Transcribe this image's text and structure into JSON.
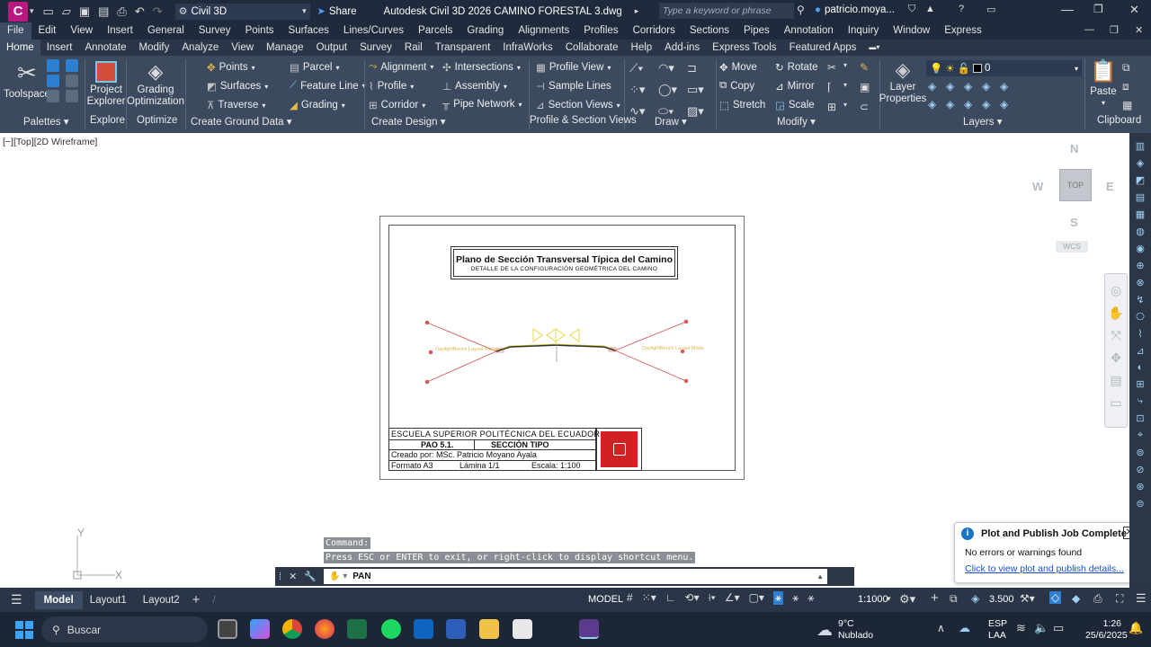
{
  "app": {
    "title": "Autodesk Civil 3D 2026   CAMINO FORESTAL 3.dwg",
    "workspace": "Civil 3D",
    "share": "Share",
    "search_placeholder": "Type a keyword or phrase",
    "user": "patricio.moya...",
    "app_letter": "C"
  },
  "menu": [
    "File",
    "Edit",
    "View",
    "Insert",
    "General",
    "Survey",
    "Points",
    "Surfaces",
    "Lines/Curves",
    "Parcels",
    "Grading",
    "Alignments",
    "Profiles",
    "Corridors",
    "Sections",
    "Pipes",
    "Annotation",
    "Inquiry",
    "Window",
    "Express"
  ],
  "tabs": [
    "Home",
    "Insert",
    "Annotate",
    "Modify",
    "Analyze",
    "View",
    "Manage",
    "Output",
    "Survey",
    "Rail",
    "Transparent",
    "InfraWorks",
    "Collaborate",
    "Help",
    "Add-ins",
    "Express Tools",
    "Featured Apps"
  ],
  "ribbon": {
    "toolspace": "Toolspace",
    "project_explorer": "Project Explorer",
    "grading_opt": "Grading Optimization",
    "points": "Points",
    "surfaces": "Surfaces",
    "traverse": "Traverse",
    "parcel": "Parcel",
    "feature_line": "Feature Line",
    "grading": "Grading",
    "alignment": "Alignment",
    "profile": "Profile",
    "corridor": "Corridor",
    "intersections": "Intersections",
    "assembly": "Assembly",
    "pipe_network": "Pipe Network",
    "profile_view": "Profile View",
    "sample_lines": "Sample Lines",
    "section_views": "Section Views",
    "move": "Move",
    "copy": "Copy",
    "stretch": "Stretch",
    "rotate": "Rotate",
    "mirror": "Mirror",
    "scale": "Scale",
    "layer_props": "Layer Properties",
    "layer_value": "0",
    "paste": "Paste",
    "panels": {
      "palettes": "Palettes",
      "explore": "Explore",
      "optimize": "Optimize",
      "ground": "Create Ground Data",
      "design": "Create Design",
      "profsec": "Profile & Section Views",
      "draw": "Draw",
      "modify": "Modify",
      "layers": "Layers",
      "clipboard": "Clipboard"
    }
  },
  "viewport": {
    "label": "[−][Top][2D Wireframe]",
    "compass": {
      "n": "N",
      "s": "S",
      "e": "E",
      "w": "W",
      "top": "TOP",
      "wcs": "WCS"
    }
  },
  "drawing": {
    "title": "Plano de Sección Transversal Típica del Camino",
    "subtitle": "DETALLE DE LA CONFIGURACIÓN GEOMÉTRICA DEL CAMINO",
    "daylight_left": "DaylightBench Layout Mode",
    "daylight_right": "DaylightBench Layout Mode",
    "titleblock": {
      "school": "ESCUELA SUPERIOR POLITÉCNICA DEL ECUADOR",
      "pao": "PAO 5.1.",
      "seccion": "SECCIÓN TIPO",
      "creado": "Creado por: MSc. Patricio Moyano Ayala",
      "formato": "Formato A3",
      "lamina": "Lámina 1/1",
      "escala": "Escala: 1:100"
    }
  },
  "command": {
    "history1": "Command:",
    "history2": "Press ESC or ENTER to exit, or right-click to display shortcut menu.",
    "current": "PAN"
  },
  "notification": {
    "title": "Plot and Publish Job Complete",
    "message": "No errors or warnings found",
    "link": "Click to view plot and publish details..."
  },
  "status": {
    "model_tab": "Model",
    "layout1": "Layout1",
    "layout2": "Layout2",
    "model": "MODEL",
    "scale": "1:1000",
    "value": "3.500"
  },
  "taskbar": {
    "search": "Buscar",
    "weather_temp": "9°C",
    "weather_desc": "Nublado",
    "lang1": "ESP",
    "lang2": "LAA",
    "time": "1:26",
    "date": "25/6/2025"
  }
}
